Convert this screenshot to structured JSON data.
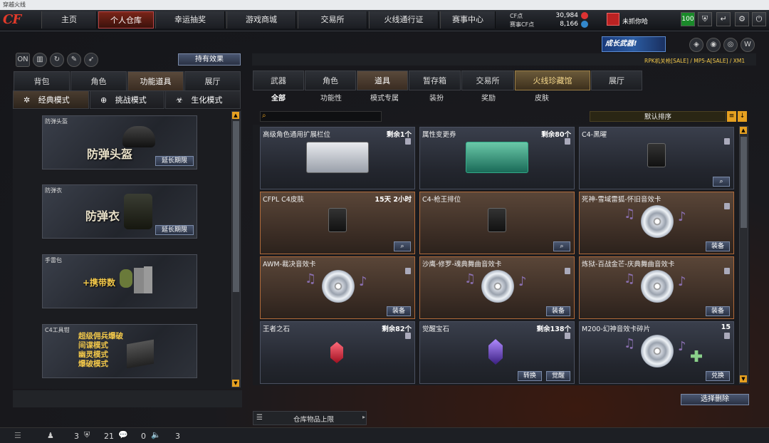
{
  "window": {
    "title": "穿越火线"
  },
  "brand": {
    "logo": "CF"
  },
  "nav": {
    "tabs": [
      "主页",
      "个人仓库",
      "幸运抽奖",
      "游戏商城",
      "交易所",
      "火线通行证",
      "赛事中心"
    ],
    "active": 1
  },
  "points": {
    "cf_label": "CF点",
    "cf_value": "30,984",
    "bonus_label": "赛事CF点",
    "bonus_value": "8,166"
  },
  "user": {
    "name": "未抓你哈",
    "level": "100"
  },
  "left": {
    "effects_button": "持有效果",
    "tabs": [
      "背包",
      "角色",
      "功能道具",
      "展厅"
    ],
    "active_tab": 2,
    "modes": [
      "经典模式",
      "挑战模式",
      "生化模式"
    ],
    "cards": [
      {
        "title": "防弹头盔",
        "big": "防弹头盔",
        "button": "延长期限"
      },
      {
        "title": "防弹衣",
        "big": "防弹衣",
        "button": "延长期限"
      },
      {
        "title": "手雷包",
        "big": "+携带数"
      },
      {
        "title": "C4工具钳",
        "lines": [
          "超级佣兵爆破",
          "间谍模式",
          "幽灵模式",
          "爆破模式"
        ]
      }
    ]
  },
  "right": {
    "banner_text": "成长武器!",
    "marquee": "RPK机关枪[SALE] / MP5-A[SALE] / XM1",
    "tabs": [
      "武器",
      "角色",
      "道具",
      "暂存箱",
      "交易所",
      "火线珍藏馆",
      "展厅"
    ],
    "active_tab": 2,
    "gold_tab": 5,
    "subtabs": [
      "全部",
      "功能性",
      "模式专属",
      "装扮",
      "奖励",
      "皮肤"
    ],
    "active_subtab": 0,
    "sort_label": "默认排序",
    "search_placeholder": "",
    "items": [
      {
        "name": "高级角色通用扩展栏位",
        "count": "剩余1个"
      },
      {
        "name": "属性变更券",
        "count": "剩余80个"
      },
      {
        "name": "C4-黑曜",
        "count": ""
      },
      {
        "name": "CFPL C4皮肤",
        "count": "15天 2小时"
      },
      {
        "name": "C4-枪王排位",
        "count": ""
      },
      {
        "name": "死神-雪域雷狐-怀旧音效卡",
        "count": "",
        "button": "装备"
      },
      {
        "name": "AWM-裁决音效卡",
        "count": "",
        "button": "装备"
      },
      {
        "name": "沙鹰-修罗-魂典舞曲音效卡",
        "count": "",
        "button": "装备"
      },
      {
        "name": "炼狱-百战金芒-庆典舞曲音效卡",
        "count": "",
        "button": "装备"
      },
      {
        "name": "王者之石",
        "count": "剩余82个"
      },
      {
        "name": "觉醒宝石",
        "count": "剩余138个",
        "buttons": [
          "转换",
          "觉醒"
        ]
      },
      {
        "name": "M200-幻神音效卡碎片",
        "count": "15",
        "button": "兑换"
      }
    ],
    "delete_button": "选择删除",
    "warehouse_limit": "仓库物品上限"
  },
  "status": {
    "players": "3",
    "shield": "21",
    "chat": "0",
    "volume": "3"
  }
}
